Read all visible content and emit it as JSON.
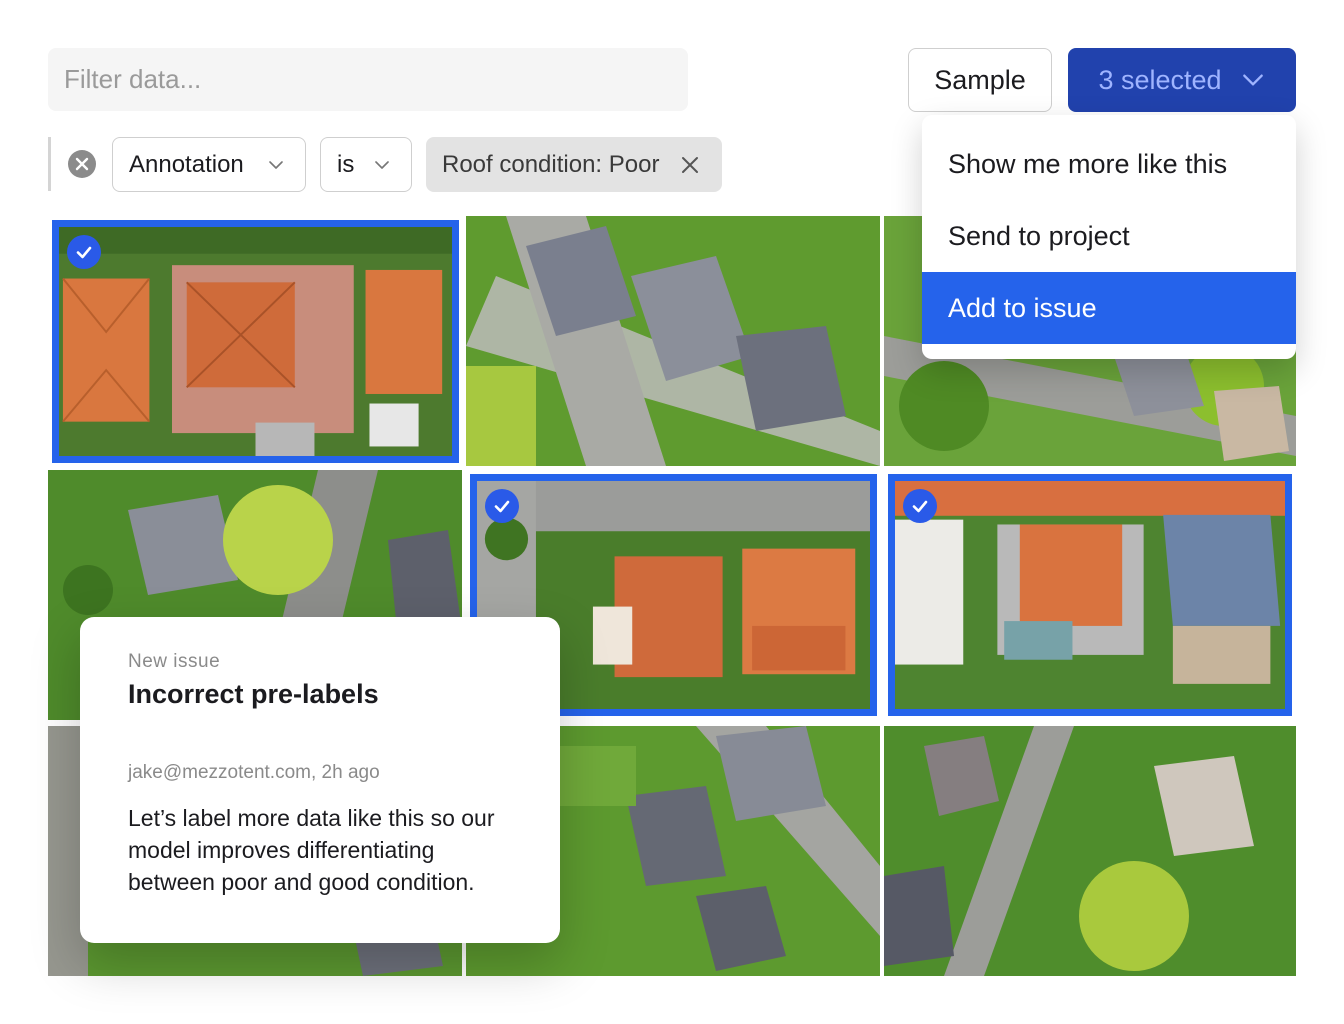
{
  "search": {
    "placeholder": "Filter data..."
  },
  "toolbar": {
    "sample_label": "Sample",
    "selected_label": "3 selected"
  },
  "filter": {
    "field": "Annotation",
    "operator": "is",
    "value_chip": "Roof condition: Poor"
  },
  "menu": {
    "items": [
      "Show me more like this",
      "Send to project",
      "Add to issue"
    ],
    "active_index": 2
  },
  "issue": {
    "kicker": "New issue",
    "title": "Incorrect pre-labels",
    "author_meta": "jake@mezzotent.com, 2h ago",
    "body": "Let’s label more data like this so our model improves differentiating between poor and good condition."
  },
  "images": [
    {
      "roof": "terracotta",
      "selected": true
    },
    {
      "roof": "grey",
      "selected": false
    },
    {
      "roof": "grey",
      "selected": false
    },
    {
      "roof": "grey",
      "selected": false
    },
    {
      "roof": "terracotta",
      "selected": true
    },
    {
      "roof": "mixed",
      "selected": true
    },
    {
      "roof": "grey",
      "selected": false
    },
    {
      "roof": "grey",
      "selected": false
    },
    {
      "roof": "grey",
      "selected": false
    }
  ],
  "colors": {
    "accent": "#2563eb",
    "primary_button": "#2142ad",
    "primary_button_text": "#9fb4ff"
  }
}
